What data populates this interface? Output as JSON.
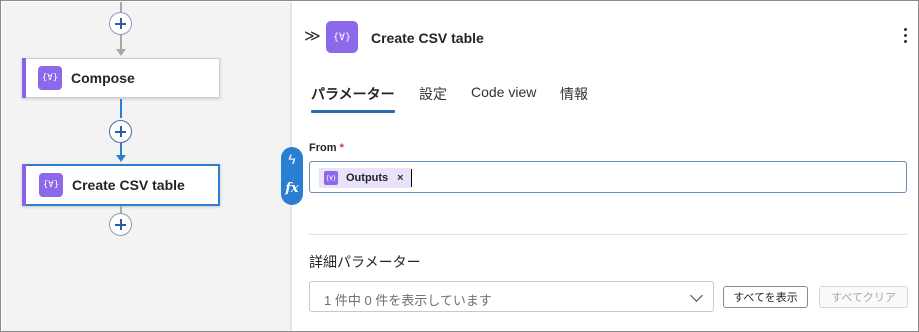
{
  "canvas": {
    "steps": [
      {
        "id": "compose",
        "label": "Compose",
        "icon": "data-operation-icon",
        "selected": false
      },
      {
        "id": "create-csv",
        "label": "Create CSV table",
        "icon": "data-operation-icon",
        "selected": true
      }
    ],
    "action_glyph": "{∀}"
  },
  "panel": {
    "title": "Create CSV table",
    "icon": "data-operation-icon",
    "icon_glyph": "{∀}",
    "collapse_glyph": "≫",
    "tabs": [
      {
        "label": "パラメーター",
        "active": true
      },
      {
        "label": "設定",
        "active": false
      },
      {
        "label": "Code view",
        "active": false
      },
      {
        "label": "情報",
        "active": false
      }
    ],
    "from": {
      "label": "From",
      "required_mark": "*",
      "token_label": "Outputs",
      "token_close": "×"
    },
    "advanced": {
      "title": "詳細パラメーター",
      "placeholder": "1 件中 0 件を表示しています",
      "show_all_label": "すべてを表示",
      "clear_all_label": "すべてクリア"
    },
    "pill": {
      "bolt_glyph": "ϟ",
      "fx_glyph": "fx"
    }
  },
  "colors": {
    "accent_purple": "#8e68ea",
    "selection_blue": "#2b7fd3",
    "connector_gray": "#a8a8a8",
    "tab_underline": "#2b6cb0"
  }
}
